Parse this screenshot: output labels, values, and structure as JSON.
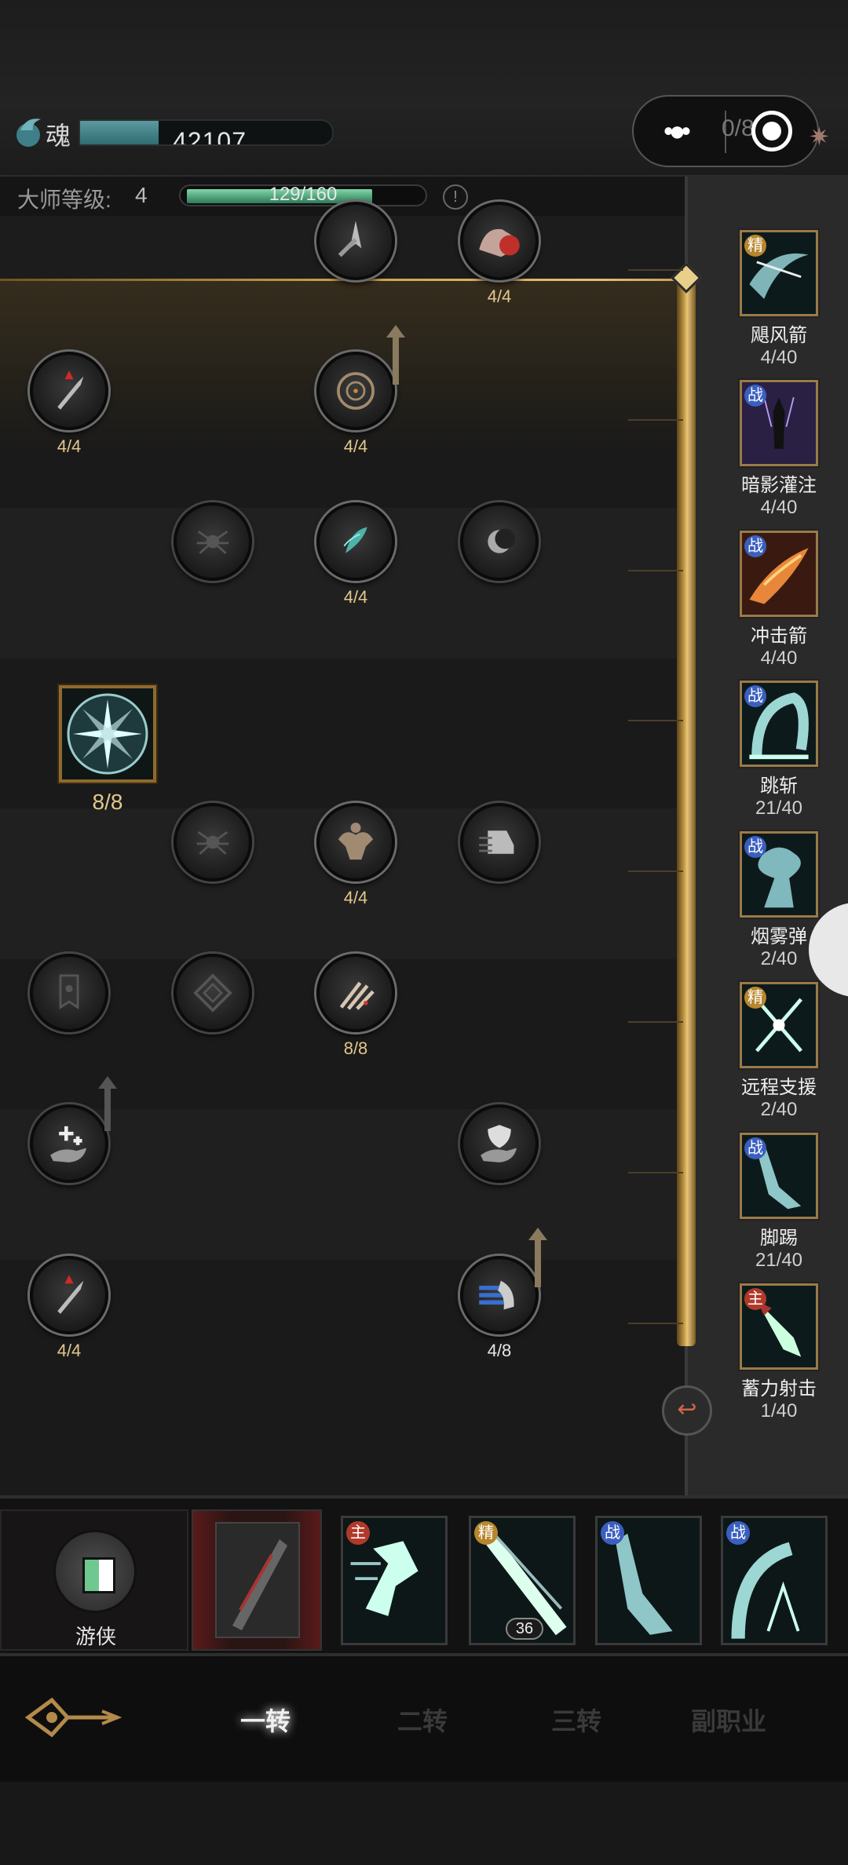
{
  "header": {
    "soul_label": "魂",
    "soul_value": "42107",
    "soul_fill_fraction": 0.31,
    "capsule_text": "0/8",
    "master_label": "大师等级:",
    "master_level": "4",
    "master_progress": "129/160",
    "master_fill_fraction": 0.806
  },
  "tree": {
    "nodes": [
      {
        "id": "r1c3",
        "label": "",
        "icon": "arrow-blade-icon",
        "active": true
      },
      {
        "id": "r1c4",
        "label": "4/4",
        "icon": "red-hand-icon",
        "active": true
      },
      {
        "id": "r2c1",
        "label": "4/4",
        "icon": "blade-up-icon",
        "active": true
      },
      {
        "id": "r2c3",
        "label": "4/4",
        "icon": "crosshair-icon",
        "active": true
      },
      {
        "id": "r3c2",
        "label": "",
        "icon": "spider-icon",
        "active": false
      },
      {
        "id": "r3c3",
        "label": "4/4",
        "icon": "leaf-icon",
        "active": true
      },
      {
        "id": "r3c4",
        "label": "",
        "icon": "moon-icon",
        "active": false
      },
      {
        "id": "r4c1",
        "label": "8/8",
        "icon": "wheel-icon",
        "active": true
      },
      {
        "id": "r5c2",
        "label": "",
        "icon": "spider-icon",
        "active": false
      },
      {
        "id": "r5c3",
        "label": "4/4",
        "icon": "muscle-icon",
        "active": true
      },
      {
        "id": "r5c4",
        "label": "",
        "icon": "speed-boot-icon",
        "active": false
      },
      {
        "id": "r6c1",
        "label": "",
        "icon": "banner-icon",
        "active": false
      },
      {
        "id": "r6c2",
        "label": "",
        "icon": "diamond-cross-icon",
        "active": false
      },
      {
        "id": "r6c3",
        "label": "8/8",
        "icon": "claw-icon",
        "active": true
      },
      {
        "id": "r7c1",
        "label": "",
        "icon": "healing-hand-icon",
        "active": false
      },
      {
        "id": "r7c4",
        "label": "",
        "icon": "shield-hand-icon",
        "active": false
      },
      {
        "id": "r8c1",
        "label": "4/4",
        "icon": "blade-up-icon",
        "active": true
      },
      {
        "id": "r8c4",
        "label": "4/8",
        "icon": "dash-icon",
        "active": true
      }
    ]
  },
  "skills": [
    {
      "tag": "精",
      "tag_color": "#b8862e",
      "name": "飓风箭",
      "count": "4/40"
    },
    {
      "tag": "战",
      "tag_color": "#3a5fc0",
      "name": "暗影灌注",
      "count": "4/40"
    },
    {
      "tag": "战",
      "tag_color": "#3a5fc0",
      "name": "冲击箭",
      "count": "4/40"
    },
    {
      "tag": "战",
      "tag_color": "#3a5fc0",
      "name": "跳斩",
      "count": "21/40"
    },
    {
      "tag": "战",
      "tag_color": "#3a5fc0",
      "name": "烟雾弹",
      "count": "2/40"
    },
    {
      "tag": "精",
      "tag_color": "#b8862e",
      "name": "远程支援",
      "count": "2/40"
    },
    {
      "tag": "战",
      "tag_color": "#3a5fc0",
      "name": "脚踢",
      "count": "21/40"
    },
    {
      "tag": "主",
      "tag_color": "#b03a2a",
      "name": "蓄力射击",
      "count": "1/40"
    }
  ],
  "hotbar": {
    "class_name": "游侠",
    "slots": [
      {
        "tag": "主",
        "tag_color": "#b03a2a",
        "badge": ""
      },
      {
        "tag": "精",
        "tag_color": "#b8862e",
        "badge": "36"
      },
      {
        "tag": "战",
        "tag_color": "#3a5fc0",
        "badge": ""
      },
      {
        "tag": "战",
        "tag_color": "#3a5fc0",
        "badge": ""
      }
    ]
  },
  "tabs": [
    "一转",
    "二转",
    "三转",
    "副职业"
  ],
  "colors": {
    "gold": "#c9a14c",
    "accent": "#e2c88c"
  }
}
